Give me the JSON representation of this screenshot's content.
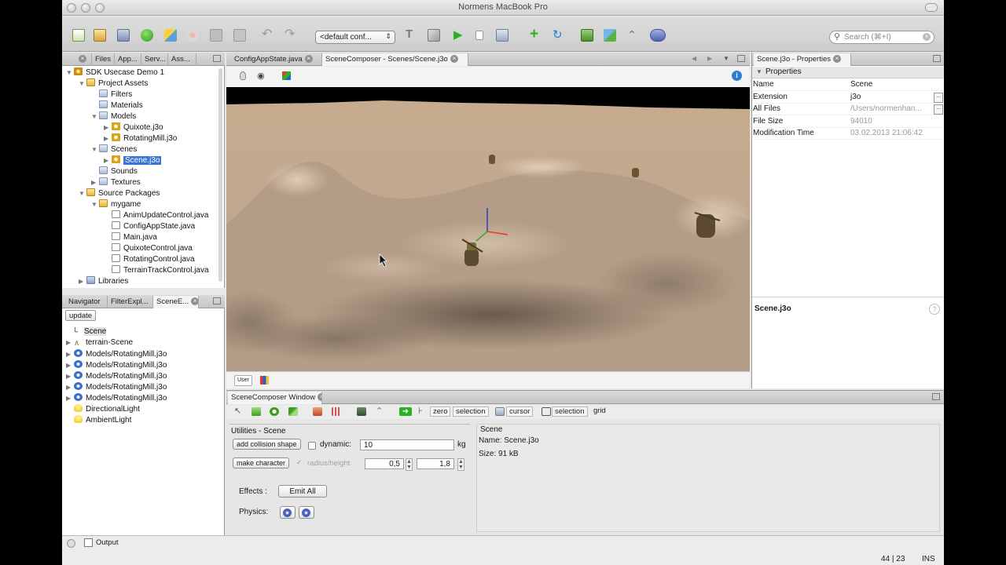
{
  "titlebar": {
    "title": "Normens MacBook Pro"
  },
  "toolbar": {
    "config_combo": "<default conf...",
    "search_placeholder": "Search (⌘+I)"
  },
  "project_tabs": [
    "Files",
    "App...",
    "Serv...",
    "Ass..."
  ],
  "project_tree": [
    {
      "label": "SDK Usecase Demo 1",
      "twisty": "▼",
      "icon": "project-icon",
      "depth": 0
    },
    {
      "label": "Project Assets",
      "twisty": "▼",
      "icon": "package-icon",
      "depth": 1
    },
    {
      "label": "Filters",
      "twisty": "",
      "icon": "folder-icon",
      "depth": 2
    },
    {
      "label": "Materials",
      "twisty": "",
      "icon": "folder-icon",
      "depth": 2
    },
    {
      "label": "Models",
      "twisty": "▼",
      "icon": "folder-icon",
      "depth": 2
    },
    {
      "label": "Quixote.j3o",
      "twisty": "▶",
      "icon": "model-icon",
      "depth": 3
    },
    {
      "label": "RotatingMill.j3o",
      "twisty": "▶",
      "icon": "model-icon",
      "depth": 3
    },
    {
      "label": "Scenes",
      "twisty": "▼",
      "icon": "folder-icon",
      "depth": 2
    },
    {
      "label": "Scene.j3o",
      "twisty": "▶",
      "icon": "model-icon",
      "depth": 3,
      "selected": true
    },
    {
      "label": "Sounds",
      "twisty": "",
      "icon": "folder-icon",
      "depth": 2
    },
    {
      "label": "Textures",
      "twisty": "▶",
      "icon": "folder-icon",
      "depth": 2
    },
    {
      "label": "Source Packages",
      "twisty": "▼",
      "icon": "package-icon",
      "depth": 1
    },
    {
      "label": "mygame",
      "twisty": "▼",
      "icon": "package-icon",
      "depth": 2
    },
    {
      "label": "AnimUpdateControl.java",
      "twisty": "",
      "icon": "java-file-icon",
      "depth": 3
    },
    {
      "label": "ConfigAppState.java",
      "twisty": "",
      "icon": "java-file-icon",
      "depth": 3
    },
    {
      "label": "Main.java",
      "twisty": "",
      "icon": "java-file-icon",
      "depth": 3
    },
    {
      "label": "QuixoteControl.java",
      "twisty": "",
      "icon": "java-file-icon",
      "depth": 3
    },
    {
      "label": "RotatingControl.java",
      "twisty": "",
      "icon": "java-file-icon",
      "depth": 3
    },
    {
      "label": "TerrainTrackControl.java",
      "twisty": "",
      "icon": "java-file-icon",
      "depth": 3
    },
    {
      "label": "Libraries",
      "twisty": "▶",
      "icon": "library-icon",
      "depth": 1
    }
  ],
  "nav_tabs": [
    "Navigator",
    "FilterExpl...",
    "SceneE..."
  ],
  "nav_update_label": "update",
  "scene_tree": [
    {
      "label": "Scene",
      "twisty": "",
      "icon": "node-icon",
      "root": true
    },
    {
      "label": "terrain-Scene",
      "twisty": "▶",
      "icon": "terrain-icon"
    },
    {
      "label": "Models/RotatingMill.j3o",
      "twisty": "▶",
      "icon": "spatial-icon"
    },
    {
      "label": "Models/RotatingMill.j3o",
      "twisty": "▶",
      "icon": "spatial-icon"
    },
    {
      "label": "Models/RotatingMill.j3o",
      "twisty": "▶",
      "icon": "spatial-icon"
    },
    {
      "label": "Models/RotatingMill.j3o",
      "twisty": "▶",
      "icon": "spatial-icon"
    },
    {
      "label": "Models/RotatingMill.j3o",
      "twisty": "▶",
      "icon": "spatial-icon"
    },
    {
      "label": "DirectionalLight",
      "twisty": "",
      "icon": "light-icon"
    },
    {
      "label": "AmbientLight",
      "twisty": "",
      "icon": "light-icon"
    }
  ],
  "editor_tabs": [
    {
      "label": "ConfigAppState.java",
      "active": false
    },
    {
      "label": "SceneComposer - Scenes/Scene.j3o",
      "active": true
    }
  ],
  "viewport_bottom": {
    "user_label": "User"
  },
  "properties": {
    "tab_label": "Scene.j3o - Properties",
    "section": "Properties",
    "rows": [
      {
        "key": "Name",
        "value": "Scene",
        "dim": false,
        "button": false
      },
      {
        "key": "Extension",
        "value": "j3o",
        "dim": false,
        "button": true
      },
      {
        "key": "All Files",
        "value": "/Users/normenhan...",
        "dim": true,
        "button": true
      },
      {
        "key": "File Size",
        "value": "94010",
        "dim": true,
        "button": false
      },
      {
        "key": "Modification Time",
        "value": "03.02.2013 21:06:42",
        "dim": true,
        "button": false
      }
    ],
    "description_title": "Scene.j3o",
    "help_glyph": "?"
  },
  "composer": {
    "tab_label": "SceneComposer Window",
    "tools": {
      "zero": "zero",
      "selection": "selection",
      "cursor": "cursor",
      "selection2": "selection",
      "grid": "grid"
    },
    "utilities": {
      "title": "Utilities - Scene",
      "add_collision": "add collision shape",
      "dynamic_label": "dynamic:",
      "dynamic_value": "10",
      "unit": "kg",
      "make_character": "make character",
      "radius_height_label": "radius/height",
      "radius_value": "0,5",
      "height_value": "1,8",
      "effects_label": "Effects :",
      "emit_all": "Emit All",
      "physics_label": "Physics:"
    },
    "scene_info": {
      "title": "Scene",
      "name_line": "Name: Scene.j3o",
      "size_line": "Size: 91 kB"
    }
  },
  "statusbar": {
    "output_label": "Output",
    "position": "44 | 23",
    "mode": "INS"
  },
  "colors": {
    "selection": "#3875d7",
    "terrain_light": "#cdb49a",
    "terrain_dark": "#7a6a5a",
    "play_green": "#2fae27"
  }
}
